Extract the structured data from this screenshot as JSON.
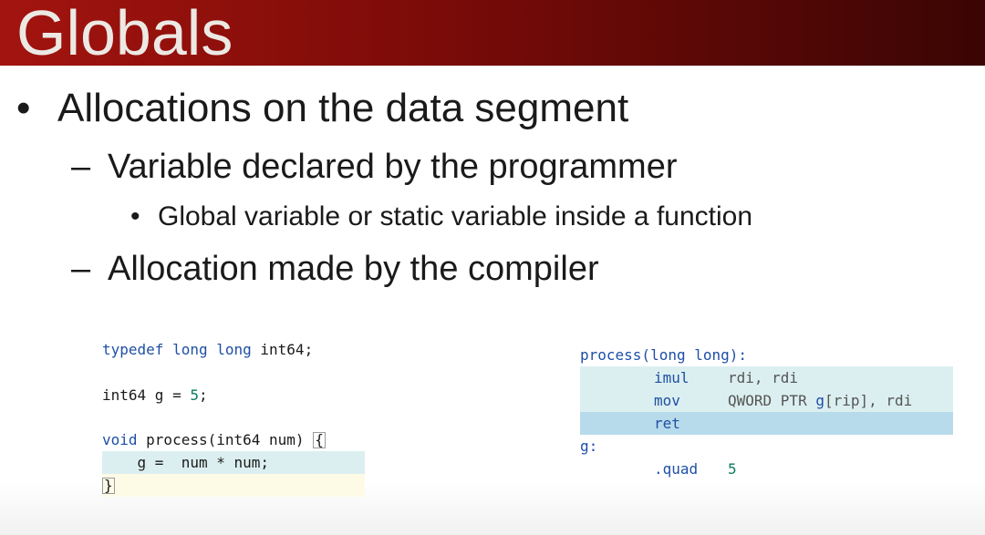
{
  "slide": {
    "title": "Globals",
    "bullets": {
      "l1_mark": "•",
      "l1_text": "Allocations on the data segment",
      "l2a_mark": "–",
      "l2a_text": "Variable declared by the programmer",
      "l3_mark": "•",
      "l3_text": "Global variable or static variable inside a function",
      "l2b_mark": "–",
      "l2b_text": "Allocation made by the compiler"
    }
  },
  "source_code": {
    "line1_kw": "typedef long long",
    "line1_rest": " int64;",
    "line2_pre": "int64 g = ",
    "line2_num": "5",
    "line2_post": ";",
    "line3_kw": "void",
    "line3_rest": " process(int64 num) ",
    "line3_brace": "{",
    "line4": "    g =  num * num;",
    "line5": "}"
  },
  "assembly": {
    "func_label": "process(long long):",
    "instr1": "imul",
    "op1": "rdi, rdi",
    "instr2": "mov",
    "op2_pre": "QWORD PTR ",
    "op2_g": "g",
    "op2_post": "[rip], rdi",
    "instr3": "ret",
    "g_label": "g:",
    "quad": ".quad",
    "quad_val": "5"
  },
  "colors": {
    "title_bar_start": "#a3140f",
    "title_bar_end": "#3a0504",
    "keyword": "#1f4fa6",
    "number": "#0b7b62",
    "highlight_current": "#dceff0",
    "highlight_selected": "#b7dbea"
  }
}
